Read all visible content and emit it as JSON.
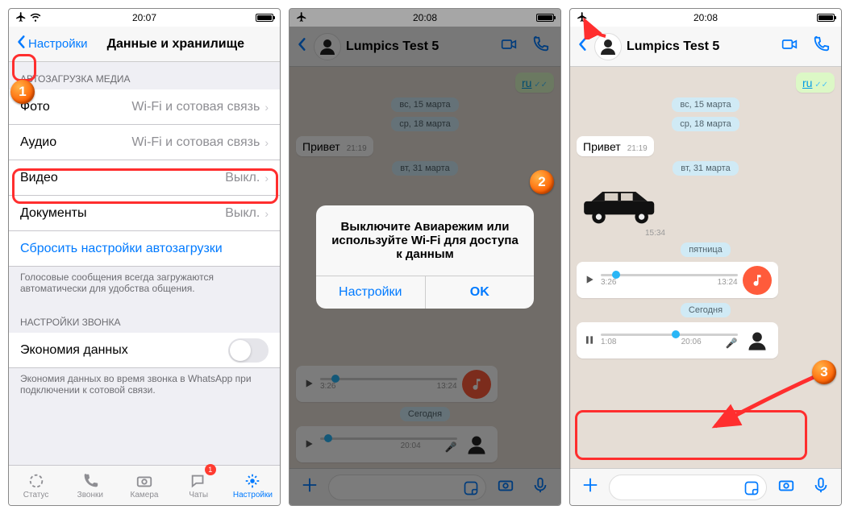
{
  "phone1": {
    "status_time": "20:07",
    "back_label": "Настройки",
    "title": "Данные и хранилище",
    "media_header": "АВТОЗАГРУЗКА МЕДИА",
    "rows": {
      "photo": {
        "label": "Фото",
        "value": "Wi-Fi и сотовая связь"
      },
      "audio": {
        "label": "Аудио",
        "value": "Wi-Fi и сотовая связь"
      },
      "video": {
        "label": "Видео",
        "value": "Выкл."
      },
      "documents": {
        "label": "Документы",
        "value": "Выкл."
      }
    },
    "reset_label": "Сбросить настройки автозагрузки",
    "footnote": "Голосовые сообщения всегда загружаются автоматически для удобства общения.",
    "call_header": "НАСТРОЙКИ ЗВОНКА",
    "economy_label": "Экономия данных",
    "economy_footnote": "Экономия данных во время звонка в WhatsApp при подключении к сотовой связи.",
    "tabs": {
      "status": "Статус",
      "calls": "Звонки",
      "camera": "Камера",
      "chats": "Чаты",
      "settings": "Настройки",
      "chat_badge": "1"
    }
  },
  "phone2": {
    "status_time": "20:08",
    "contact": "Lumpics Test 5",
    "dates": {
      "d1": "вс, 15 марта",
      "d2": "ср, 18 марта",
      "d3": "вт, 31 марта",
      "today": "Сегодня"
    },
    "link_text": "ru",
    "hello": "Привет",
    "hello_time": "21:19",
    "audio1": {
      "t1": "3:26",
      "t2": "13:24"
    },
    "voice": {
      "t1": "",
      "t2": "20:04"
    },
    "alert": {
      "msg": "Выключите Авиарежим или используйте Wi-Fi для доступа к данным",
      "settings": "Настройки",
      "ok": "OK"
    }
  },
  "phone3": {
    "status_time": "20:08",
    "contact": "Lumpics Test 5",
    "dates": {
      "d1": "вс, 15 марта",
      "d2": "ср, 18 марта",
      "d3": "вт, 31 марта",
      "friday": "пятница",
      "today": "Сегодня"
    },
    "link_text": "ru",
    "hello": "Привет",
    "hello_time": "21:19",
    "car_time": "15:34",
    "audio1": {
      "t1": "3:26",
      "t2": "13:24"
    },
    "voice_playing": {
      "t1": "1:08",
      "t2": "20:06"
    }
  },
  "badges": {
    "b1": "1",
    "b2": "2",
    "b3": "3"
  }
}
